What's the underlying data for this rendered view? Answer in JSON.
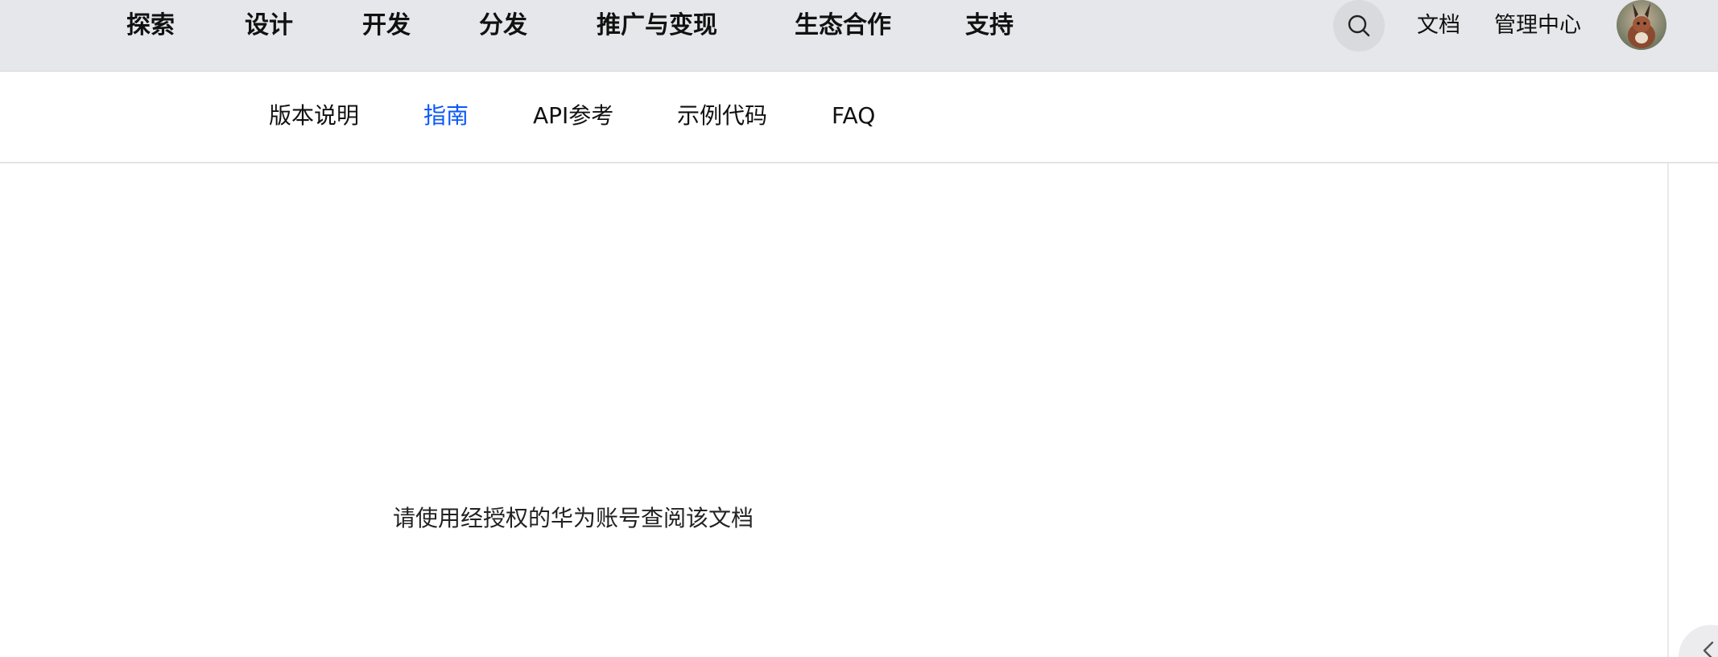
{
  "top_nav": {
    "items": [
      {
        "label": "探索"
      },
      {
        "label": "设计"
      },
      {
        "label": "开发"
      },
      {
        "label": "分发"
      },
      {
        "label": "推广与变现"
      },
      {
        "label": "生态合作"
      },
      {
        "label": "支持"
      }
    ],
    "search_icon": "search-icon",
    "docs_label": "文档",
    "console_label": "管理中心"
  },
  "sub_nav": {
    "items": [
      {
        "label": "版本说明",
        "active": false
      },
      {
        "label": "指南",
        "active": true
      },
      {
        "label": "API参考",
        "active": false
      },
      {
        "label": "示例代码",
        "active": false
      },
      {
        "label": "FAQ",
        "active": false
      }
    ],
    "active_color": "#0a59f7"
  },
  "content": {
    "message": "请使用经授权的华为账号查阅该文档"
  }
}
